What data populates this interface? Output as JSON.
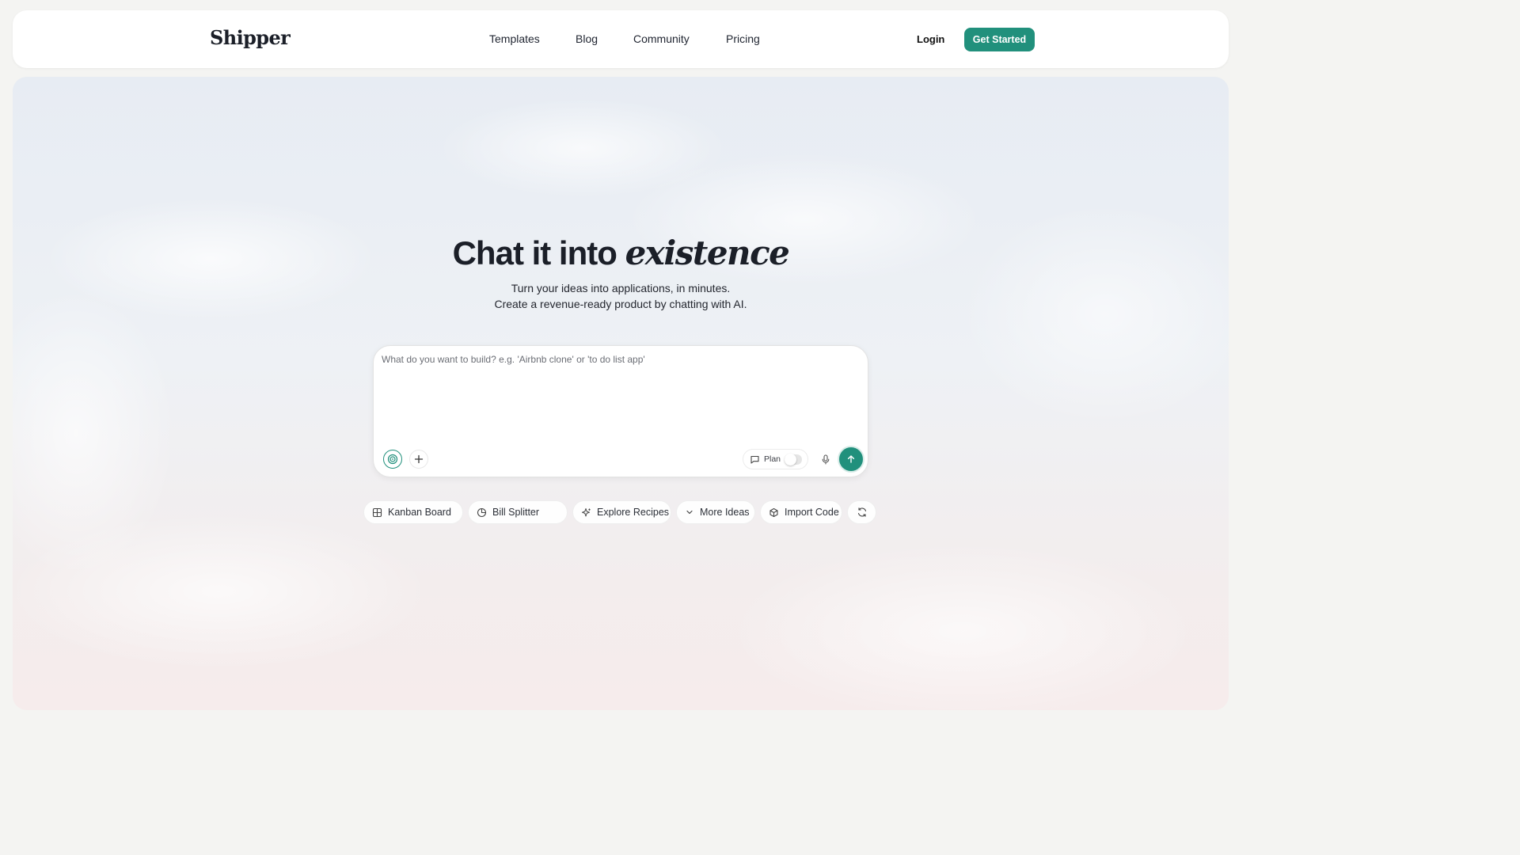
{
  "brand": {
    "name": "Shipper",
    "accent_color": "#21907c"
  },
  "nav": {
    "links": [
      "Templates",
      "Blog",
      "Community",
      "Pricing"
    ],
    "login_label": "Login",
    "cta_label": "Get Started"
  },
  "hero": {
    "title_prefix": "Chat it into",
    "title_italic": "existence",
    "subtitle_line1": "Turn your ideas into applications, in minutes.",
    "subtitle_line2": "Create a revenue-ready product by chatting with AI."
  },
  "prompt": {
    "placeholder": "What do you want to build? e.g. 'Airbnb clone' or 'to do list app'",
    "value": "",
    "plan_label": "Plan",
    "plan_enabled": false,
    "icons": [
      "target-icon",
      "plus-icon",
      "chat-icon",
      "microphone-icon",
      "arrow-up-icon"
    ]
  },
  "suggestions": [
    {
      "label": "Kanban Board",
      "icon": "grid-icon"
    },
    {
      "label": "Bill Splitter",
      "icon": "pie-chart-icon"
    },
    {
      "label": "Explore Recipes",
      "icon": "sparkle-icon"
    },
    {
      "label": "More Ideas",
      "icon": "chevron-down-icon"
    },
    {
      "label": "Import Code",
      "icon": "cube-icon"
    },
    {
      "label": "",
      "icon": "refresh-icon"
    }
  ]
}
